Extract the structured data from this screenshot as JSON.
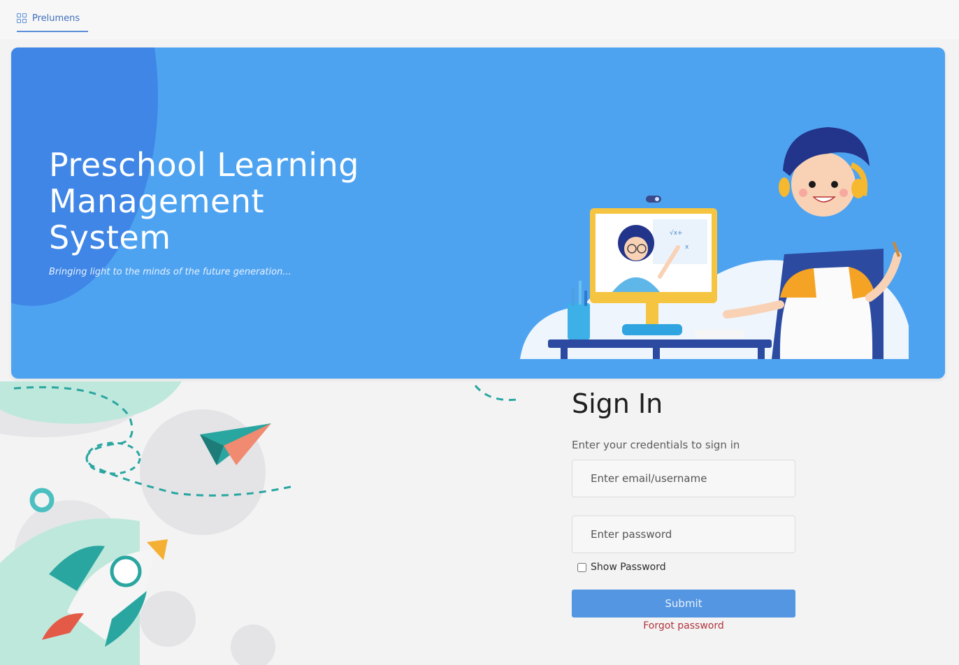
{
  "tab": {
    "label": "Prelumens",
    "icon": "grid-icon"
  },
  "hero": {
    "title_line1": "Preschool Learning",
    "title_line2": "Management",
    "title_line3": "System",
    "subtitle": "Bringing light to the minds of the future generation...",
    "background_color": "#4ea3f1"
  },
  "signin": {
    "title": "Sign In",
    "subtitle": "Enter your credentials to sign in",
    "email_placeholder": "Enter email/username",
    "password_placeholder": "Enter password",
    "show_password_label": "Show Password",
    "submit_label": "Submit",
    "forgot_label": "Forgot password",
    "accent_color": "#5596e2",
    "forgot_color": "#b2353b"
  }
}
